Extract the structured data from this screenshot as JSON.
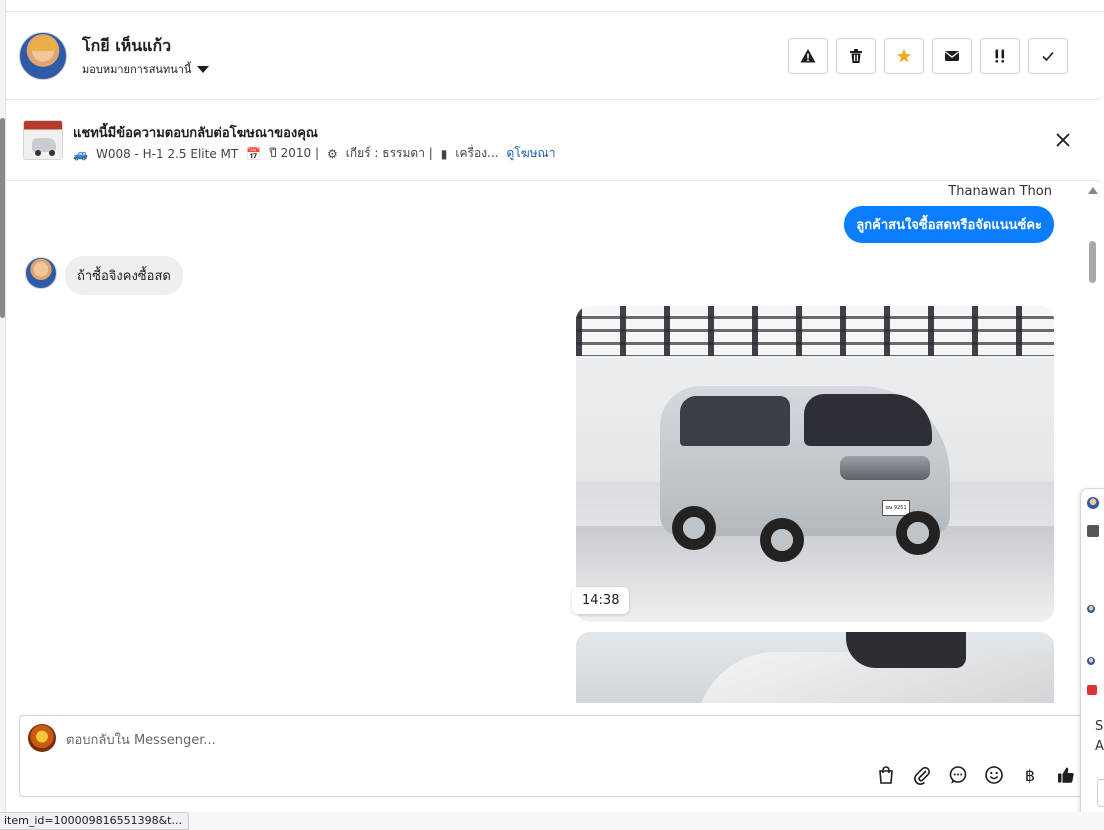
{
  "header": {
    "contact_name": "โกยี เห็นแก้ว",
    "assign_label": "มอบหมายการสนทนานี้",
    "actions": [
      {
        "name": "warning-button",
        "icon": "warning-icon"
      },
      {
        "name": "delete-button",
        "icon": "trash-icon"
      },
      {
        "name": "star-button",
        "icon": "star-icon"
      },
      {
        "name": "mark-unread-button",
        "icon": "envelope-icon"
      },
      {
        "name": "follow-up-button",
        "icon": "priority-icon"
      },
      {
        "name": "mark-done-button",
        "icon": "check-icon"
      }
    ],
    "star_color": "#f5a623"
  },
  "ad_banner": {
    "title": "แชทนี้มีข้อความตอบกลับต่อโฆษณาของคุณ",
    "desc_model": "W008 - H-1 2.5 Elite MT",
    "desc_year": "ปี 2010 |",
    "desc_gear": "เกียร์ : ธรรมดา |",
    "desc_engine": "เครื่อง...",
    "link": "ดูโฆษณา"
  },
  "chat": {
    "outgoing_sender": "Thanawan Thon",
    "outgoing_message": "ลูกค้าสนใจซื้อสดหรือจัดแนนซ์คะ",
    "incoming_message": "ถ้าซื้อจิงคงซื้อสด",
    "photo_timestamp": "14:38",
    "plate_text": "ฆษ 9251",
    "outgoing_color": "#0a7cff"
  },
  "composer": {
    "placeholder": "ตอบกลับใน Messenger...",
    "tools": [
      "shopping-bag-icon",
      "paperclip-icon",
      "chat-bubble-icon",
      "emoji-icon",
      "baht-icon",
      "thumbs-up-icon"
    ],
    "baht_symbol": "฿"
  },
  "side_popup": {
    "letter_1": "S",
    "letter_2": "A"
  },
  "status_bar": {
    "url": "item_id=100009816551398&t..."
  }
}
